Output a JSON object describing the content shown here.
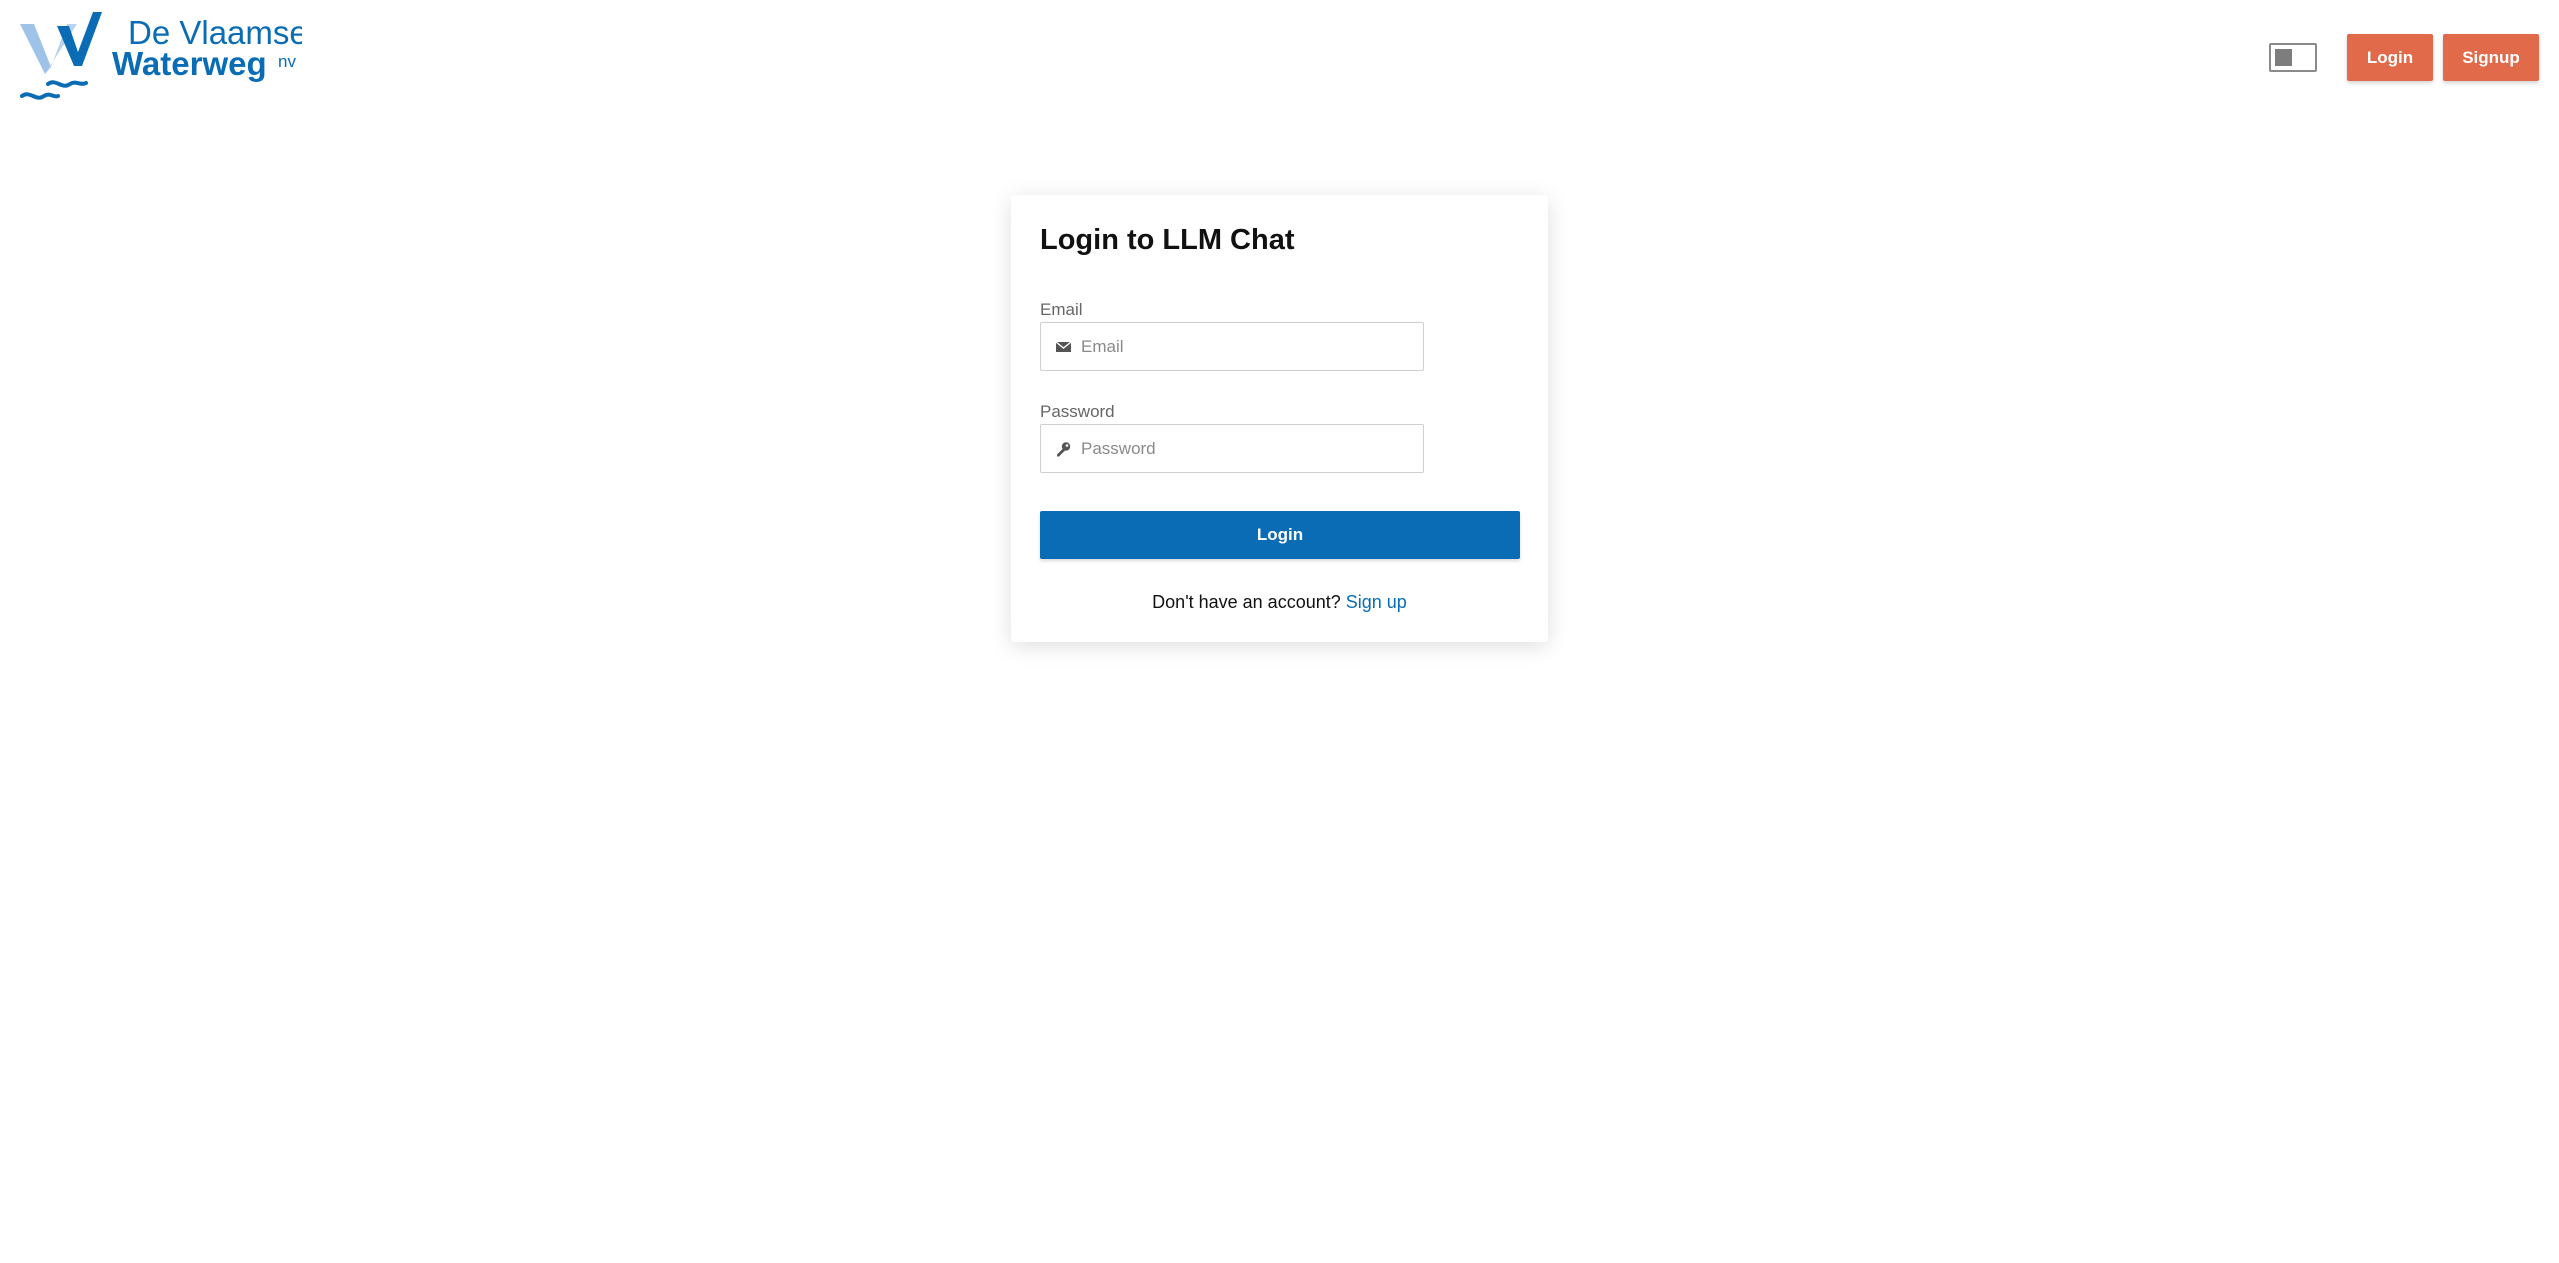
{
  "brand": {
    "line1": "De Vlaamse",
    "line2": "Waterweg",
    "suffix": "nv",
    "color_dark": "#0a6cb5",
    "color_light": "#9ec2e8"
  },
  "header": {
    "theme_toggle_icon": "theme-toggle",
    "login_label": "Login",
    "signup_label": "Signup",
    "button_color": "#e06a4a"
  },
  "login_card": {
    "title": "Login to LLM Chat",
    "email": {
      "label": "Email",
      "placeholder": "Email",
      "value": "",
      "icon": "envelope-icon"
    },
    "password": {
      "label": "Password",
      "placeholder": "Password",
      "value": "",
      "icon": "key-icon"
    },
    "submit_label": "Login",
    "submit_color": "#0a6cb5",
    "signup_prompt": "Don't have an account?",
    "signup_link": "Sign up"
  }
}
